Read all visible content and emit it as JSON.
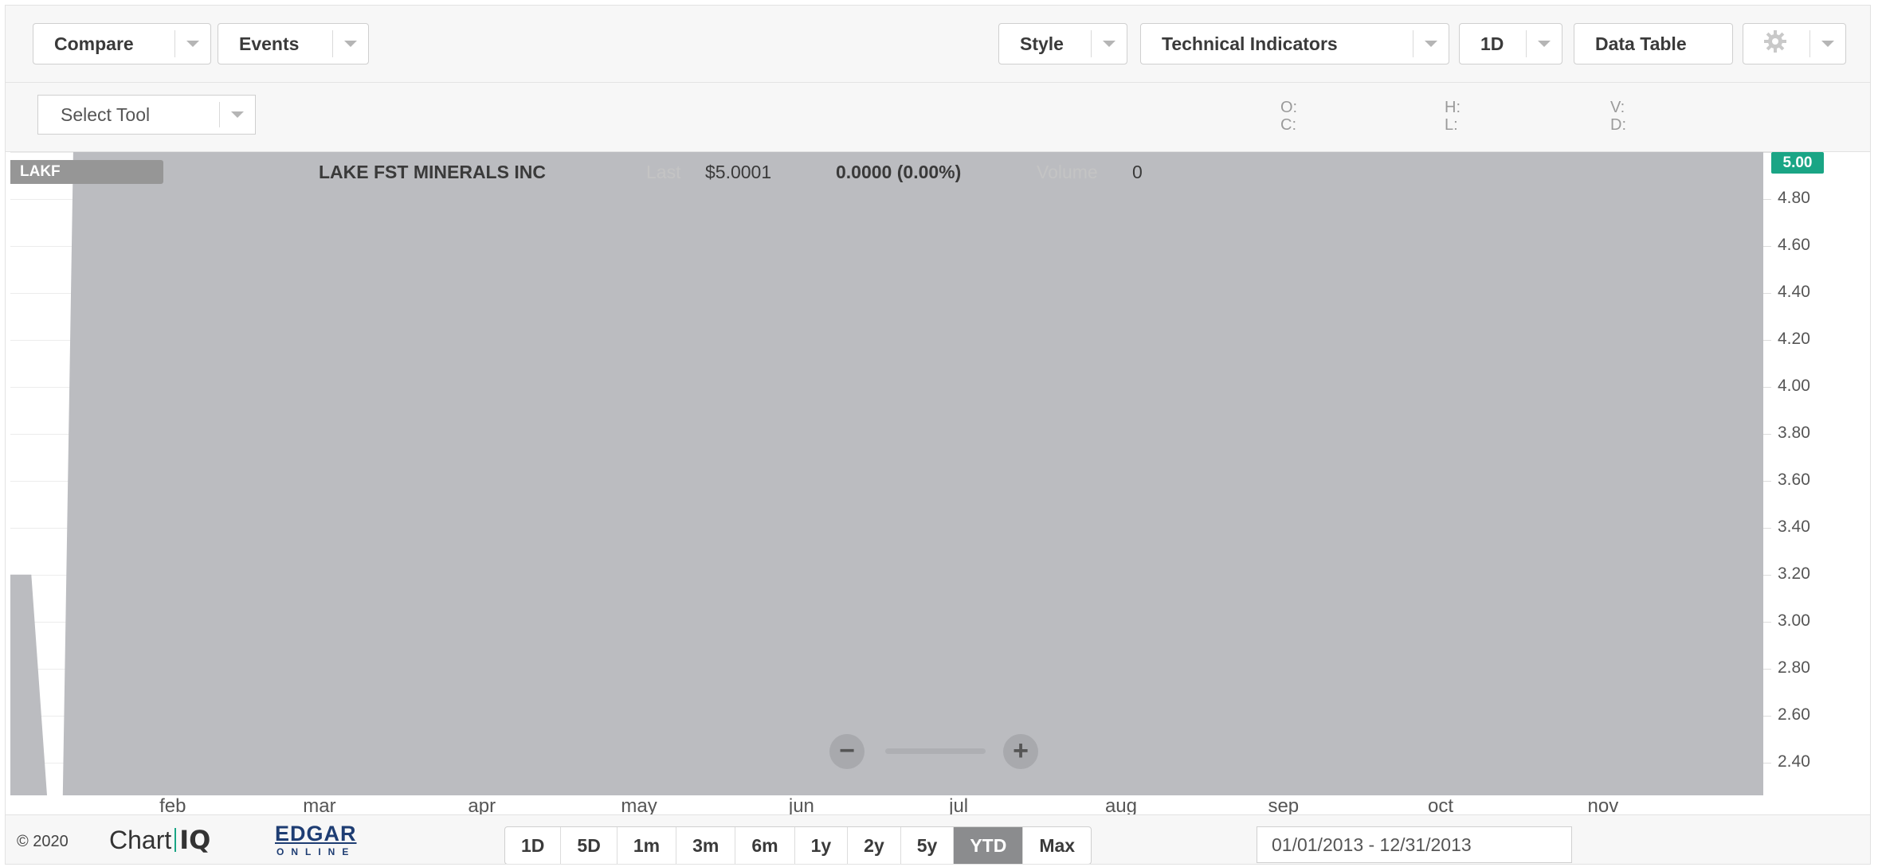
{
  "toolbar": {
    "compare": "Compare",
    "events": "Events",
    "style": "Style",
    "technical_indicators": "Technical Indicators",
    "interval": "1D",
    "data_table": "Data Table",
    "settings_icon": "gear-icon"
  },
  "subbar": {
    "select_tool": "Select Tool",
    "ohlc": {
      "o": "O:",
      "c": "C:",
      "h": "H:",
      "l": "L:",
      "v": "V:",
      "d": "D:"
    }
  },
  "legend": {
    "symbol": "LAKF",
    "name": "LAKE FST MINERALS INC",
    "last_label": "Last",
    "last_value": "$5.0001",
    "change": "0.0000 (0.00%)",
    "volume_label": "Volume",
    "volume_value": "0"
  },
  "colors": {
    "mountain_fill": "#bbbcc0",
    "price_badge": "#1aa585",
    "active_range": "#8b8c8e"
  },
  "chart_data": {
    "type": "area",
    "y_ticks": [
      "5.00",
      "4.80",
      "4.60",
      "4.40",
      "4.20",
      "4.00",
      "3.80",
      "3.60",
      "3.40",
      "3.20",
      "3.00",
      "2.80",
      "2.60",
      "2.40"
    ],
    "x_ticks": [
      "feb",
      "mar",
      "apr",
      "may",
      "jun",
      "jul",
      "aug",
      "sep",
      "oct",
      "nov"
    ],
    "current_price_badge": "5.00",
    "ylim": [
      2.26,
      5.0
    ],
    "series": [
      {
        "points": [
          {
            "x": "2013-01-01",
            "y": 3.2
          },
          {
            "x": "2013-01-05",
            "y": 3.2
          },
          {
            "x": "2013-01-08",
            "y": 2.26
          },
          {
            "x": "2013-01-11",
            "y": 2.26
          },
          {
            "x": "2013-01-13",
            "y": 5.0
          },
          {
            "x": "2013-12-31",
            "y": 5.0
          }
        ]
      }
    ]
  },
  "zoom": {
    "out": "−",
    "in": "+"
  },
  "footer": {
    "copyright": "© 2020",
    "chartiq_left": "Chart",
    "chartiq_right": "IQ",
    "edgar_top": "EDGAR",
    "edgar_bottom": "ONLINE",
    "ranges": [
      "1D",
      "5D",
      "1m",
      "3m",
      "6m",
      "1y",
      "2y",
      "5y",
      "YTD",
      "Max"
    ],
    "active_range": "YTD",
    "date_range": "01/01/2013 - 12/31/2013"
  }
}
